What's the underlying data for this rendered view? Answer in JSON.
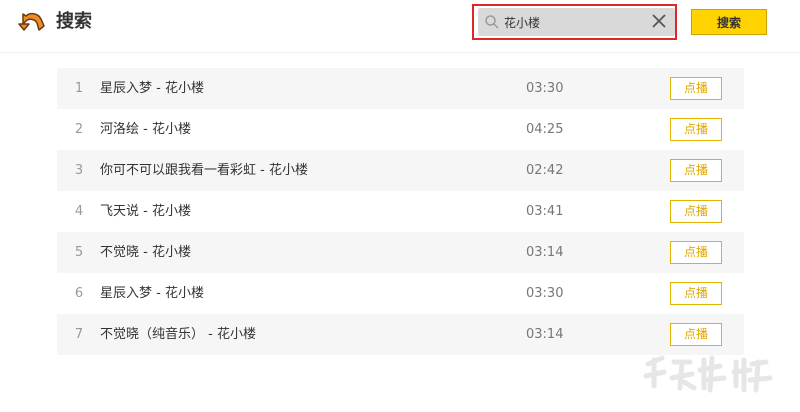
{
  "header": {
    "title": "搜索",
    "back_icon": "back-arrow-icon"
  },
  "search": {
    "value": "花小楼",
    "search_icon": "search-icon",
    "clear_icon": "close-icon",
    "button_label": "搜索"
  },
  "songs": [
    {
      "index": "1",
      "title": "星辰入梦 - 花小楼",
      "duration": "03:30",
      "action": "点播"
    },
    {
      "index": "2",
      "title": "河洛绘 - 花小楼",
      "duration": "04:25",
      "action": "点播"
    },
    {
      "index": "3",
      "title": "你可不可以跟我看一看彩虹 - 花小楼",
      "duration": "02:42",
      "action": "点播"
    },
    {
      "index": "4",
      "title": "飞天说 - 花小楼",
      "duration": "03:41",
      "action": "点播"
    },
    {
      "index": "5",
      "title": "不觉晓 - 花小楼",
      "duration": "03:14",
      "action": "点播"
    },
    {
      "index": "6",
      "title": "星辰入梦 - 花小楼",
      "duration": "03:30",
      "action": "点播"
    },
    {
      "index": "7",
      "title": "不觉晓（纯音乐） - 花小楼",
      "duration": "03:14",
      "action": "点播"
    }
  ],
  "colors": {
    "accent": "#ffd200",
    "play_border": "#e2b400",
    "highlight_outline": "#e0262a",
    "back_icon_orange": "#f08a24"
  }
}
